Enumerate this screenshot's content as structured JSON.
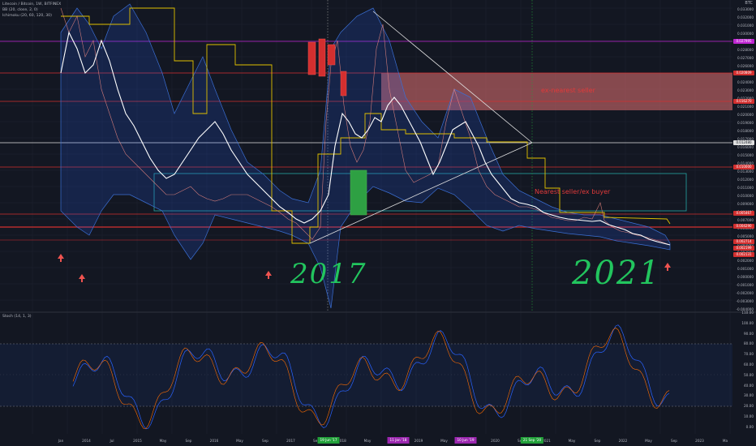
{
  "legend": {
    "symbol_line": "Litecoin / Bitcoin, 1W, BITFINEX",
    "bb_line": "BB (20, close, 2, 0)",
    "ichimoku_line": "Ichimoku (20, 60, 120, 30)",
    "stoch_line": "Stoch (14, 1, 3)"
  },
  "corner": {
    "currency": "BTC",
    "eye_label": "■"
  },
  "annotations": {
    "resistance_label": "ex-nearest seller",
    "seller_buyer_label": "Nearest seller/ex buyer",
    "year_2017": "2017",
    "year_2021": "2021"
  },
  "price_axis": {
    "labels": [
      "0.033000",
      "0.032000",
      "0.031000",
      "0.030000",
      "0.029000",
      "0.028000",
      "0.027000",
      "0.026000",
      "0.025000",
      "0.024000",
      "0.023000",
      "0.022000",
      "0.021000",
      "0.020000",
      "0.019000",
      "0.018000",
      "0.017000",
      "0.016000",
      "0.015000",
      "0.014000",
      "0.013000",
      "0.012000",
      "0.011000",
      "0.010000",
      "0.009000",
      "0.008000",
      "0.007000",
      "0.006000",
      "0.005000",
      "0.004000",
      "0.003000",
      "0.002000",
      "0.001000",
      "0.000000",
      "-0.001000",
      "-0.002000",
      "-0.003000",
      "-0.004000"
    ],
    "tags": [
      {
        "text": "0.027995",
        "color": "#c026d3"
      },
      {
        "text": "0.020809",
        "color": "#d32f2f"
      },
      {
        "text": "0.016270",
        "color": "#d32f2f"
      },
      {
        "text": "0.012480",
        "color": "#e0e0e0"
      },
      {
        "text": "0.010000",
        "color": "#d32f2f"
      },
      {
        "text": "0.005467",
        "color": "#d32f2f"
      },
      {
        "text": "0.004290",
        "color": "#d32f2f"
      },
      {
        "text": "0.002714",
        "color": "#d32f2f"
      },
      {
        "text": "0.002199",
        "color": "#d32f2f"
      },
      {
        "text": "0.002131",
        "color": "#d32f2f"
      }
    ]
  },
  "stoch_axis": {
    "labels": [
      "110.00",
      "100.00",
      "90.00",
      "80.00",
      "70.00",
      "60.00",
      "50.00",
      "40.00",
      "30.00",
      "20.00",
      "10.00",
      "0.00"
    ]
  },
  "time_axis": {
    "labels": [
      "Jan",
      "2014",
      "Jul",
      "2015",
      "May",
      "Sep",
      "2016",
      "May",
      "Sep",
      "2017",
      "Sep",
      "2018",
      "May",
      "Sep",
      "2019",
      "May",
      "Sep",
      "2020",
      "Sep",
      "2021",
      "May",
      "Sep",
      "2022",
      "May",
      "Sep",
      "2023",
      "Ma"
    ],
    "highlights": [
      {
        "text": "19 Jun '17",
        "color": "#22a13a"
      },
      {
        "text": "11 Jan '18",
        "color": "#9c27b0"
      },
      {
        "text": "10 Jun '19",
        "color": "#9c27b0"
      },
      {
        "text": "21 Sep '20",
        "color": "#22a13a"
      }
    ]
  },
  "colors": {
    "background": "#131722",
    "grid": "#1e2230",
    "bb": "#3b6fd4",
    "ichimoku": "#e0c000",
    "price": "#ffffff",
    "stoch_k": "#2962ff",
    "stoch_d": "#ff6d00",
    "red_level": "#d32f2f",
    "magenta_level": "#c026d3",
    "hand_green": "#22c55e"
  },
  "icons": {
    "up_arrow": "up-arrow-icon"
  }
}
